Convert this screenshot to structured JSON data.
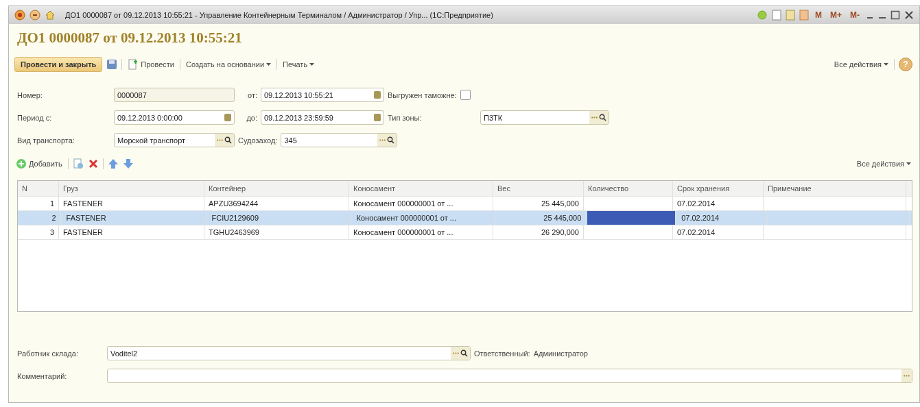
{
  "window": {
    "title": "ДО1 0000087 от 09.12.2013 10:55:21 - Управление Контейнерным Терминалом / Администратор / Упр... (1С:Предприятие)",
    "memory_buttons": [
      "M",
      "M+",
      "M-"
    ]
  },
  "heading": "ДО1 0000087 от 09.12.2013 10:55:21",
  "toolbar": {
    "primary": "Провести и закрыть",
    "post": "Провести",
    "create_based": "Создать на основании",
    "print": "Печать",
    "all_actions": "Все действия",
    "help": "?"
  },
  "fields": {
    "number_label": "Номер:",
    "number": "0000087",
    "from_label": "от:",
    "from": "09.12.2013 10:55:21",
    "customs_label": "Выгружен таможне:",
    "customs_checked": false,
    "period_label": "Период с:",
    "period_from": "09.12.2013  0:00:00",
    "to_label": "до:",
    "period_to": "09.12.2013 23:59:59",
    "zone_label": "Тип зоны:",
    "zone": "П3ТК",
    "transport_label": "Вид транспорта:",
    "transport": "Морской транспорт",
    "call_label": "Судозаход:",
    "call": "345"
  },
  "table_toolbar": {
    "add": "Добавить",
    "all_actions": "Все действия"
  },
  "table": {
    "columns": [
      {
        "label": "N",
        "focused": false
      },
      {
        "label": "Груз",
        "focused": false
      },
      {
        "label": "Контейнер",
        "focused": false
      },
      {
        "label": "Коносамент",
        "focused": false
      },
      {
        "label": "Вес",
        "focused": false
      },
      {
        "label": "Количество",
        "focused": true
      },
      {
        "label": "Срок хранения",
        "focused": false
      },
      {
        "label": "Примечание",
        "focused": false
      }
    ],
    "rows": [
      {
        "selected": false,
        "cells": [
          "1",
          "FASTENER",
          "APZU3694244",
          "Коносамент 000000001 от ...",
          "25 445,000",
          "",
          "07.02.2014",
          ""
        ]
      },
      {
        "selected": true,
        "cells": [
          "2",
          "FASTENER",
          "FCIU2129609",
          "Коносамент 000000001 от ...",
          "25 445,000",
          "",
          "07.02.2014",
          ""
        ]
      },
      {
        "selected": false,
        "cells": [
          "3",
          "FASTENER",
          "TGHU2463969",
          "Коносамент 000000001 от ...",
          "26 290,000",
          "",
          "07.02.2014",
          ""
        ]
      }
    ]
  },
  "footer": {
    "worker_label": "Работник склада:",
    "worker": "Voditel2",
    "responsible_label": "Ответственный:",
    "responsible": "Администратор",
    "comment_label": "Комментарий:"
  }
}
